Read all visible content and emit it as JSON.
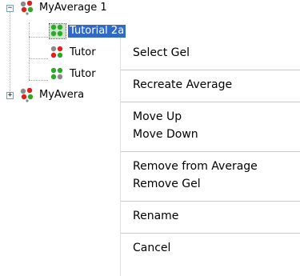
{
  "tree": {
    "nodes": [
      {
        "label": "MyAverage 1",
        "icon": "gel-average-icon",
        "expander": "−",
        "selected": false
      },
      {
        "label": "Tutorial 2a",
        "icon": "gel-icon",
        "selected": true
      },
      {
        "label": "Tutor",
        "icon": "gel-icon",
        "selected": false
      },
      {
        "label": "Tutor",
        "icon": "gel-icon",
        "selected": false
      },
      {
        "label": "MyAvera",
        "icon": "gel-average-icon",
        "expander": "+",
        "selected": false
      }
    ]
  },
  "context_menu": {
    "items": [
      {
        "label": "Select Gel"
      },
      {
        "label": "Recreate Average"
      },
      {
        "label": "Move Up"
      },
      {
        "label": "Move Down"
      },
      {
        "label": "Remove from Average"
      },
      {
        "label": "Remove Gel"
      },
      {
        "label": "Rename"
      },
      {
        "label": "Cancel"
      }
    ]
  },
  "colors": {
    "selection": "#316ac5",
    "separator": "#c9c9c9",
    "dot_red": "#e0201c",
    "dot_green": "#2fa82a",
    "dot_gray": "#8a8a8a"
  }
}
